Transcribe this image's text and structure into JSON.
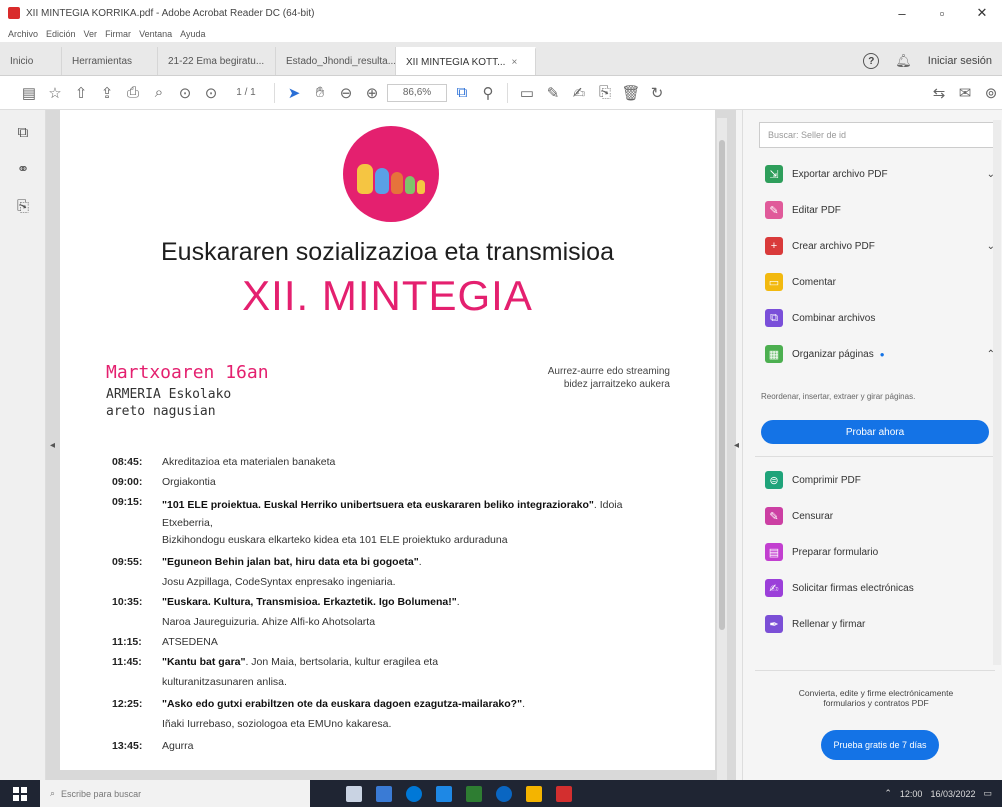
{
  "window": {
    "title": "XII MINTEGIA KORRIKA.pdf - Adobe Acrobat Reader DC (64-bit)",
    "minimize": "–",
    "maximize": "▫",
    "close": "✕"
  },
  "menu": [
    "Archivo",
    "Edición",
    "Ver",
    "Firmar",
    "Ventana",
    "Ayuda"
  ],
  "tabs": [
    {
      "label": "Inicio",
      "active": false
    },
    {
      "label": "Herramientas",
      "active": false
    },
    {
      "label": "21-22 Ema begiratu...",
      "active": false
    },
    {
      "label": "Estado_Jhondi_resulta...",
      "active": false
    },
    {
      "label": "XII MINTEGIA KOTT...",
      "active": true,
      "close": "×"
    }
  ],
  "header_right": {
    "help": "?",
    "signin": "Iniciar sesión"
  },
  "toolbar": {
    "page_indicator": "1 / 1",
    "zoom": "86,6%"
  },
  "document": {
    "title": "Euskararen sozializazioa eta transmisioa",
    "subtitle": "XII. MINTEGIA",
    "date": "Martxoaren 16an",
    "place_line1": "ARMERIA Eskolako",
    "place_line2": "areto nagusian",
    "stream_line1": "Aurrez-aurre edo streaming",
    "stream_line2": "bidez jarraitzeko aukera",
    "schedule": [
      {
        "time": "08:45:",
        "text": "Akreditazioa eta materialen banaketa",
        "bold": ""
      },
      {
        "time": "09:00:",
        "text": "Orgiakontia",
        "bold": ""
      },
      {
        "time": "09:15:",
        "bold": "\"101 ELE proiektua. Euskal Herriko unibertsuera eta euskararen beliko integraziorako\"",
        "text": ". Idoia Etxeberria,"
      },
      {
        "time": "",
        "text": "Bizkihondogu euskara elkarteko kidea eta 101 ELE proiektuko arduraduna",
        "bold": ""
      },
      {
        "time": "09:55:",
        "bold": "\"Eguneon Behin jalan bat, hiru data eta bi gogoeta\"",
        "text": "."
      },
      {
        "time": "",
        "text": "Josu Azpillaga, CodeSyntax enpresako ingeniaria.",
        "bold": ""
      },
      {
        "time": "10:35:",
        "bold": "\"Euskara. Kultura, Transmisioa. Erkaztetik. Igo Bolumena!\"",
        "text": "."
      },
      {
        "time": "",
        "text": "Naroa Jaureguizuria. Ahize Alfi-ko Ahotsolarta",
        "bold": ""
      },
      {
        "time": "11:15:",
        "text": "ATSEDENA",
        "bold": ""
      },
      {
        "time": "11:45:",
        "bold": "\"Kantu bat gara\"",
        "text": ". Jon Maia, bertsolaria, kultur eragilea eta"
      },
      {
        "time": "",
        "text": "kulturanitzasunaren anlisa.",
        "bold": ""
      },
      {
        "time": "12:25:",
        "bold": "\"Asko edo gutxi erabiltzen ote da euskara dagoen ezagutza-mailarako?\"",
        "text": "."
      },
      {
        "time": "",
        "text": "Iñaki Iurrebaso, soziologoa eta EMUno kakaresa.",
        "bold": ""
      },
      {
        "time": "13:45:",
        "text": "Agurra",
        "bold": ""
      }
    ]
  },
  "right_panel": {
    "search_placeholder": "Buscar: Seller de id",
    "items": [
      {
        "label": "Exportar archivo PDF",
        "icon": "export-pdf-icon",
        "color": "#2e9e5b",
        "chevron": "⌄"
      },
      {
        "label": "Editar PDF",
        "icon": "edit-pdf-icon",
        "color": "#e05a9a",
        "chevron": ""
      },
      {
        "label": "Crear archivo PDF",
        "icon": "create-pdf-icon",
        "color": "#d93a3a",
        "chevron": "⌄"
      },
      {
        "label": "Comentar",
        "icon": "comment-icon",
        "color": "#f2b90f",
        "chevron": ""
      },
      {
        "label": "Combinar archivos",
        "icon": "combine-icon",
        "color": "#7a4fd9",
        "chevron": ""
      },
      {
        "label": "Organizar páginas",
        "icon": "organize-pages-icon",
        "color": "#4caf50",
        "chevron": "⌃",
        "badge": "●"
      }
    ],
    "organize_desc": "Reordenar, insertar, extraer y girar páginas.",
    "organize_button": "Probar ahora",
    "items2": [
      {
        "label": "Comprimir PDF",
        "icon": "compress-pdf-icon",
        "color": "#1fa37a"
      },
      {
        "label": "Censurar",
        "icon": "redact-icon",
        "color": "#cc3fa3"
      },
      {
        "label": "Preparar formulario",
        "icon": "prepare-form-icon",
        "color": "#c23fd0"
      },
      {
        "label": "Solicitar firmas electrónicas",
        "icon": "request-signatures-icon",
        "color": "#9b3fd9"
      },
      {
        "label": "Rellenar y firmar",
        "icon": "fill-sign-icon",
        "color": "#7b4fd6"
      }
    ],
    "footer_line1": "Convierta, edite y firme electrónicamente",
    "footer_line2": "formularios y contratos PDF",
    "trial_button": "Prueba gratis de 7 días"
  },
  "taskbar": {
    "search_placeholder": "Escribe para buscar",
    "clock_time": "12:00",
    "clock_date": "16/03/2022",
    "icon_colors": [
      "#c9d3e3",
      "#3a7bd5",
      "#0078d7",
      "#1e88e5",
      "#2e7d32",
      "#0a66c2",
      "#f4b400",
      "#d32f2f"
    ]
  }
}
